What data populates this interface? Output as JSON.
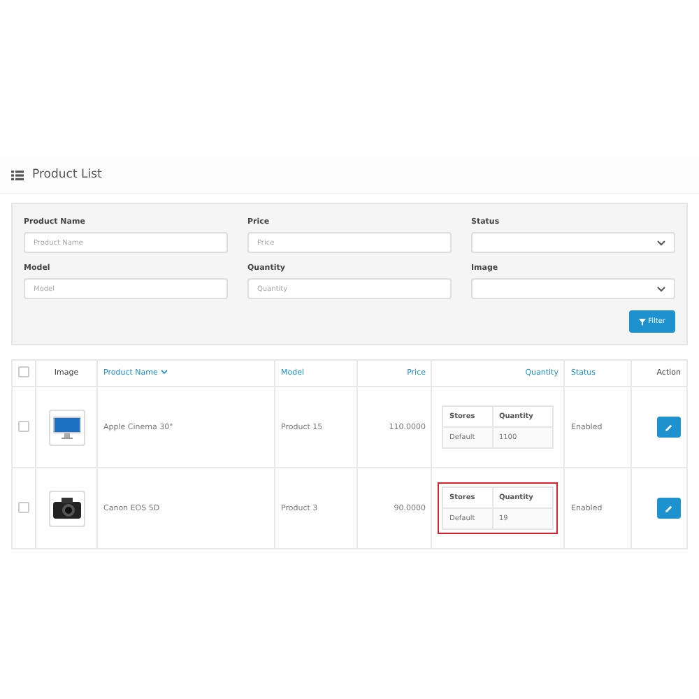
{
  "panel": {
    "title": "Product List"
  },
  "filters": [
    {
      "label": "Product Name",
      "kind": "text",
      "placeholder": "Product Name"
    },
    {
      "label": "Price",
      "kind": "text",
      "placeholder": "Price"
    },
    {
      "label": "Status",
      "kind": "select"
    },
    {
      "label": "Model",
      "kind": "text",
      "placeholder": "Model"
    },
    {
      "label": "Quantity",
      "kind": "text",
      "placeholder": "Quantity"
    },
    {
      "label": "Image",
      "kind": "select"
    }
  ],
  "filter_button": "Filter",
  "table": {
    "columns": [
      "Image",
      "Product Name",
      "Model",
      "Price",
      "Quantity",
      "Status",
      "Action"
    ],
    "select_all": false,
    "rows": [
      {
        "selected": false,
        "name": "Apple Cinema 30\"",
        "model": "Product 15",
        "price": "110.0000",
        "stock_headers": [
          "Stores",
          "Quantity"
        ],
        "stock": [
          "Default",
          "1100"
        ],
        "highlighted": false,
        "status": "Enabled"
      },
      {
        "selected": false,
        "name": "Canon EOS 5D",
        "model": "Product 3",
        "price": "90.0000",
        "stock_headers": [
          "Stores",
          "Quantity"
        ],
        "stock": [
          "Default",
          "19"
        ],
        "highlighted": true,
        "status": "Enabled"
      }
    ]
  }
}
